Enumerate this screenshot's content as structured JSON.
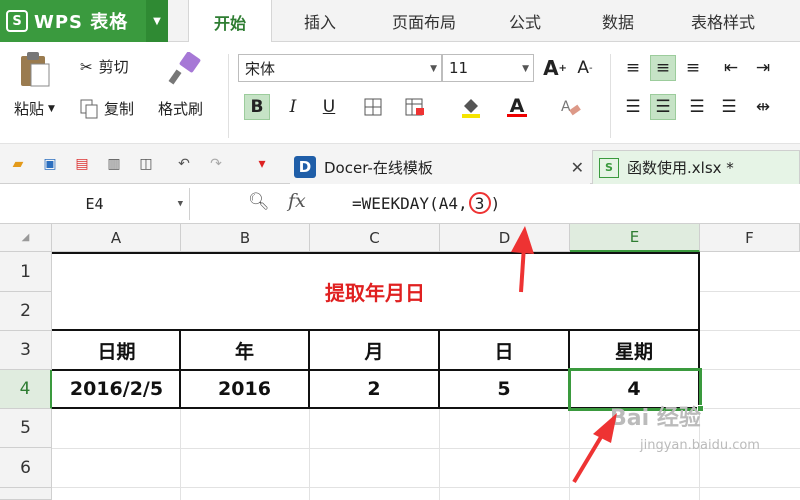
{
  "app": {
    "name": "WPS 表格",
    "logo_letter": "S",
    "brand_color": "#3a9a3e"
  },
  "ribbon_tabs": [
    {
      "label": "开始",
      "active": true
    },
    {
      "label": "插入",
      "active": false
    },
    {
      "label": "页面布局",
      "active": false
    },
    {
      "label": "公式",
      "active": false
    },
    {
      "label": "数据",
      "active": false
    },
    {
      "label": "表格样式",
      "active": false
    }
  ],
  "ribbon": {
    "paste_label": "粘贴",
    "cut_label": "剪切",
    "copy_label": "复制",
    "format_painter_label": "格式刷",
    "font_name": "宋体",
    "font_size": "11",
    "bold": "B",
    "italic": "I",
    "underline": "U",
    "grow_font": "A",
    "shrink_font": "A",
    "font_color_letter": "A"
  },
  "doc_tabs": [
    {
      "label": "Docer-在线模板",
      "closable": true
    },
    {
      "label": "函数使用.xlsx *",
      "closable": false
    }
  ],
  "formula_bar": {
    "name_box": "E4",
    "fx_label": "fx",
    "formula_prefix": "=WEEKDAY(A4,",
    "formula_circled": "3",
    "formula_suffix": ")"
  },
  "sheet": {
    "columns": [
      "A",
      "B",
      "C",
      "D",
      "E",
      "F"
    ],
    "rows": [
      "1",
      "2",
      "3",
      "4",
      "5",
      "6"
    ],
    "selected_cell": "E4",
    "title": "提取年月日",
    "headers": [
      "日期",
      "年",
      "月",
      "日",
      "星期"
    ],
    "values": [
      "2016/2/5",
      "2016",
      "2",
      "5",
      "4"
    ],
    "title_color": "#e02020",
    "annotation_color": "#e33333"
  },
  "watermark": {
    "text": "Bai 经验",
    "sub": "jingyan.baidu.com"
  }
}
